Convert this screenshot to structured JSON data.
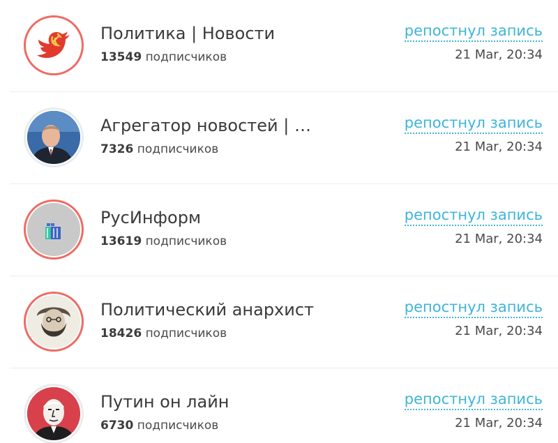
{
  "feed": {
    "items": [
      {
        "name": "Политика | Новости",
        "subscribers": "13549",
        "subscribers_label": "подписчиков",
        "action": "репостнул запись",
        "time": "21 Mar, 20:34",
        "avatar_icon": "red-bird-hammer-sickle-icon",
        "ring_color": "#ef6b63"
      },
      {
        "name": "Агрегатор новостей | Н...",
        "subscribers": "7326",
        "subscribers_label": "подписчиков",
        "action": "репостнул запись",
        "time": "21 Mar, 20:34",
        "avatar_icon": "man-portrait-icon",
        "ring_color": "#e9ecee"
      },
      {
        "name": "РусИнформ",
        "subscribers": "13619",
        "subscribers_label": "подписчиков",
        "action": "репостнул запись",
        "time": "21 Mar, 20:34",
        "avatar_icon": "building-logo-icon",
        "ring_color": "#ef6b63"
      },
      {
        "name": "Политический анархист",
        "subscribers": "18426",
        "subscribers_label": "подписчиков",
        "action": "репостнул запись",
        "time": "21 Mar, 20:34",
        "avatar_icon": "bearded-man-sketch-icon",
        "ring_color": "#ef6b63"
      },
      {
        "name": "Путин он лайн",
        "subscribers": "6730",
        "subscribers_label": "подписчиков",
        "action": "репостнул запись",
        "time": "21 Mar, 20:34",
        "avatar_icon": "man-caricature-icon",
        "ring_color": "#e9ecee"
      }
    ]
  }
}
